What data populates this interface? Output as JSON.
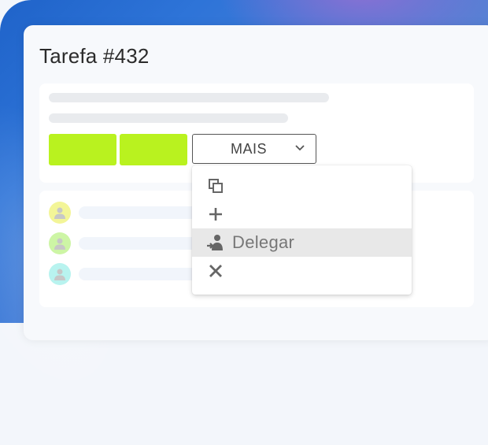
{
  "task": {
    "title": "Tarefa #432"
  },
  "toolbar": {
    "more_label": "MAIS"
  },
  "menu": {
    "items": [
      {
        "icon": "copy-icon",
        "label": ""
      },
      {
        "icon": "plus-icon",
        "label": ""
      },
      {
        "icon": "delegate-icon",
        "label": "Delegar"
      },
      {
        "icon": "close-icon",
        "label": ""
      }
    ]
  },
  "colors": {
    "accent_button": "#b9f21f",
    "menu_highlight": "#e8e8e8",
    "avatar_1": "#f3f598",
    "avatar_2": "#cdf5a5",
    "avatar_3": "#b8f3ef"
  }
}
